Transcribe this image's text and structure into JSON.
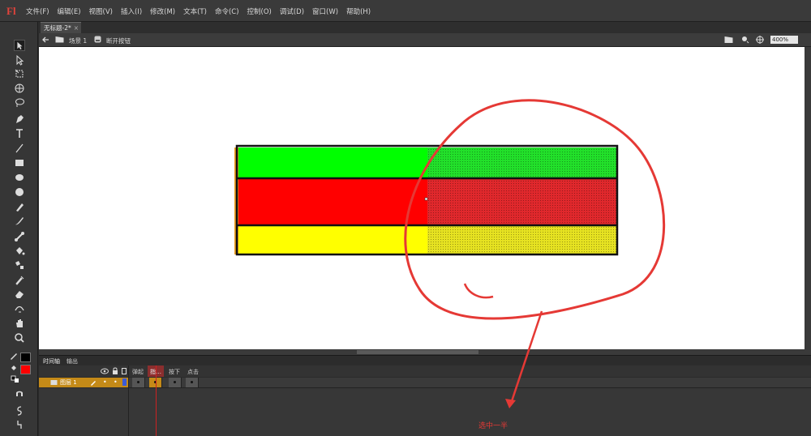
{
  "app": {
    "logo": "Fl"
  },
  "menu": [
    "文件(F)",
    "编辑(E)",
    "视图(V)",
    "插入(I)",
    "修改(M)",
    "文本(T)",
    "命令(C)",
    "控制(O)",
    "调试(D)",
    "窗口(W)",
    "帮助(H)"
  ],
  "document_tab": {
    "label": "无标题-2*",
    "close": "×"
  },
  "editbar": {
    "scene": "场景 1",
    "symbol": "断开按钮",
    "zoom": "400%"
  },
  "timeline": {
    "tabs": [
      "时间轴",
      "输出"
    ],
    "frame_labels": [
      "弹起",
      "指…",
      "按下",
      "点击"
    ],
    "layer_name": "图层 1",
    "layer_number": "1"
  },
  "stage_shape": {
    "stripes": [
      {
        "color": "#00ff00",
        "selected_color": "#22e02a"
      },
      {
        "color": "#ff0000",
        "selected_color": "#e0282c"
      },
      {
        "color": "#ffff00",
        "selected_color": "#e6e221"
      }
    ],
    "left_edge_color": "#f0a020",
    "selected_fraction": 0.5
  },
  "annotation": {
    "text": "选中一半",
    "color": "#e53935"
  },
  "colors": {
    "stroke": "#000000",
    "fill": "#ff0000"
  },
  "icons": [
    "arrow-icon",
    "subselect-icon",
    "free-transform-icon",
    "3d-rotate-icon",
    "lasso-icon",
    "pen-icon",
    "text-icon",
    "line-icon",
    "rect-icon",
    "oval-icon",
    "polystar-icon",
    "pencil-icon",
    "brush-icon",
    "bone-icon",
    "paint-bucket-icon",
    "ink-bottle-icon",
    "eyedropper-icon",
    "eraser-icon",
    "width-icon",
    "hand-icon",
    "zoom-icon"
  ]
}
